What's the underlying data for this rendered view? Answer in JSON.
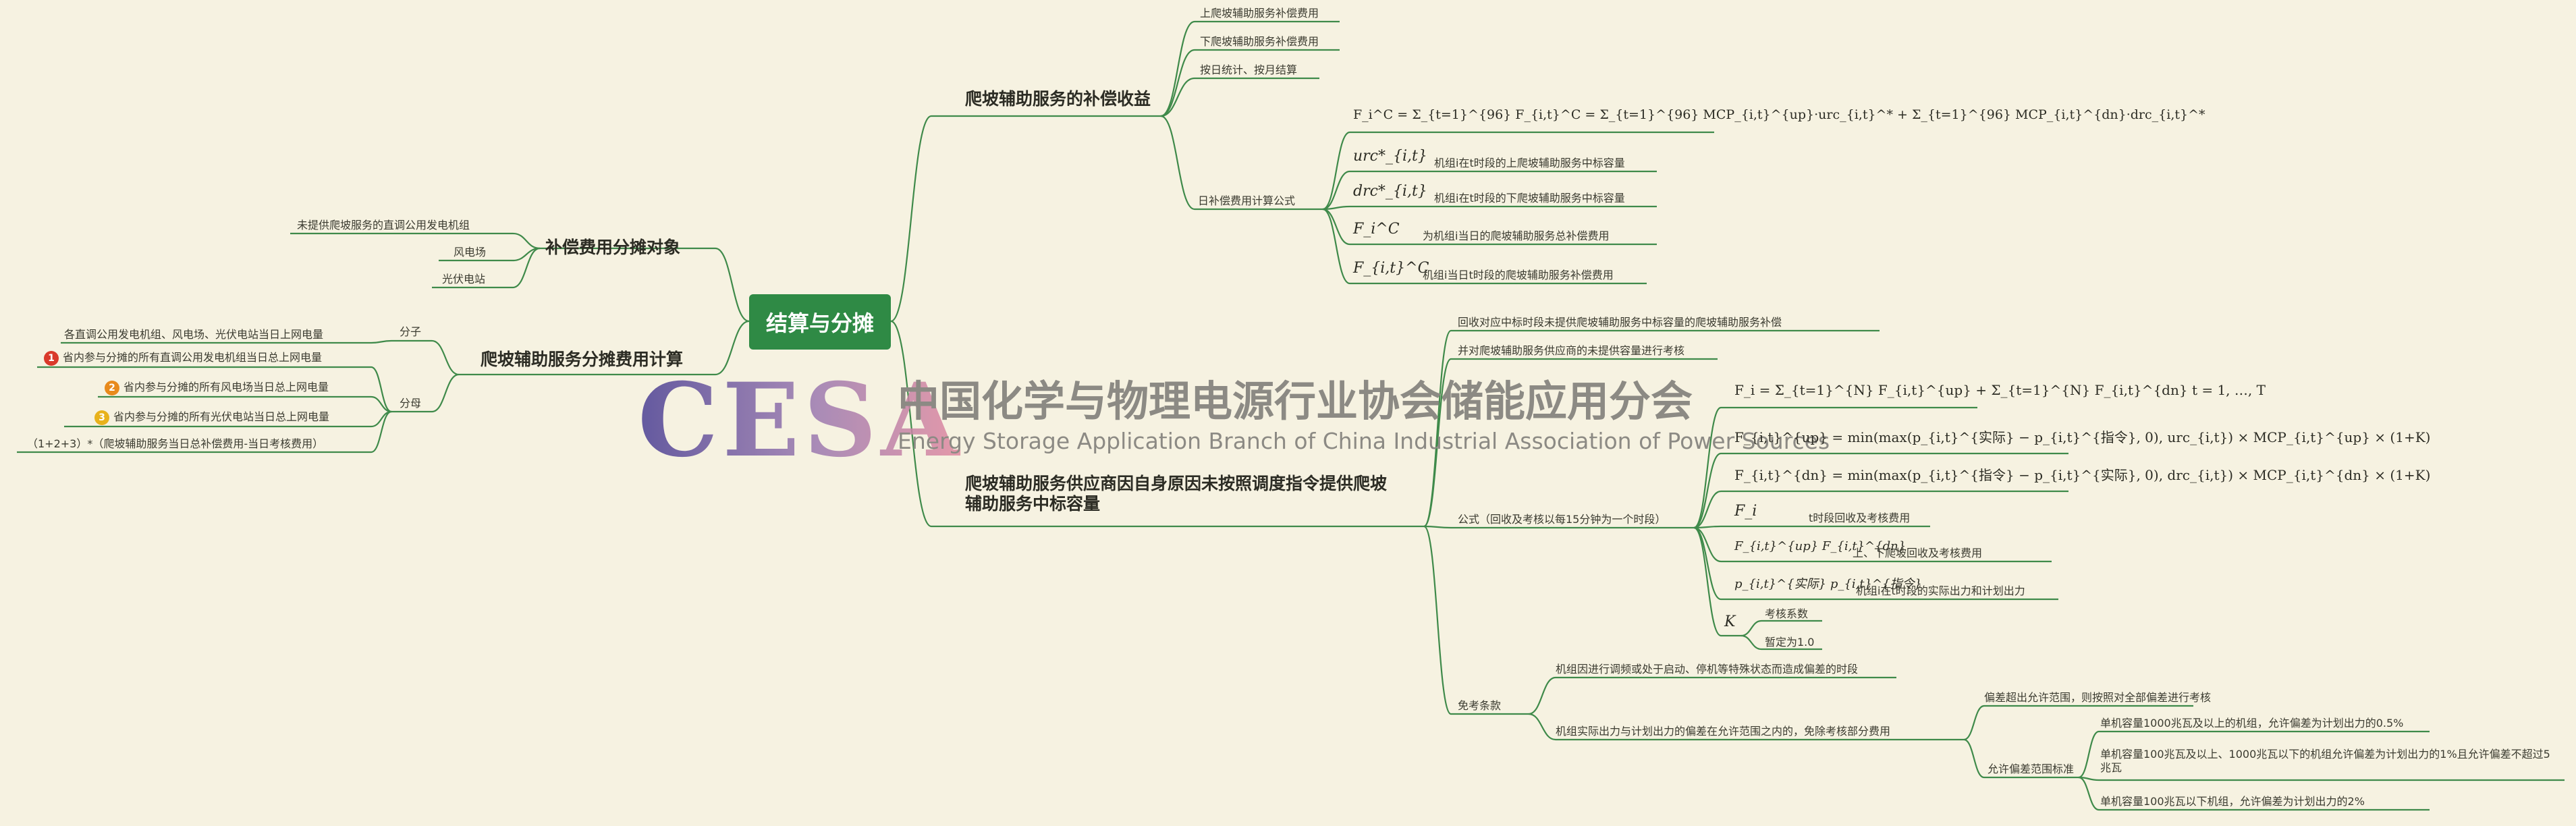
{
  "root": {
    "label": "结算与分摊"
  },
  "watermark": {
    "logo": "CESA",
    "cn": "中国化学与物理电源行业协会储能应用分会",
    "en": "Energy Storage Application Branch of China Industrial Association of Power Sources"
  },
  "right": {
    "branch1": {
      "label": "爬坡辅助服务的补偿收益",
      "items": [
        "上爬坡辅助服务补偿费用",
        "下爬坡辅助服务补偿费用",
        "按日统计、按月结算"
      ],
      "daily": {
        "label": "日补偿费用计算公式",
        "formula": "F_i^C = Σ_{t=1}^{96} F_{i,t}^C = Σ_{t=1}^{96} MCP_{i,t}^{up}·urc_{i,t}^* + Σ_{t=1}^{96} MCP_{i,t}^{dn}·drc_{i,t}^*",
        "defs": [
          {
            "sym": "urc*_{i,t}",
            "text": "机组i在t时段的上爬坡辅助服务中标容量"
          },
          {
            "sym": "drc*_{i,t}",
            "text": "机组i在t时段的下爬坡辅助服务中标容量"
          },
          {
            "sym": "F_i^C",
            "text": "为机组i当日的爬坡辅助服务总补偿费用"
          },
          {
            "sym": "F_{i,t}^C",
            "text": "机组i当日t时段的爬坡辅助服务补偿费用"
          }
        ]
      }
    },
    "branch2": {
      "label": "爬坡辅助服务供应商因自身原因未按照调度指令提供爬坡辅助服务中标容量",
      "items": [
        "回收对应中标时段未提供爬坡辅助服务中标容量的爬坡辅助服务补偿",
        "并对爬坡辅助服务供应商的未提供容量进行考核"
      ],
      "formula": {
        "label": "公式（回收及考核以每15分钟为一个时段）",
        "f1": "F_i = Σ_{t=1}^{N} F_{i,t}^{up} + Σ_{t=1}^{N} F_{i,t}^{dn}      t = 1, …, T",
        "f2": "F_{i,t}^{up} = min(max(p_{i,t}^{实际} − p_{i,t}^{指令}, 0), urc_{i,t}) × MCP_{i,t}^{up} × (1+K)",
        "f3": "F_{i,t}^{dn} = min(max(p_{i,t}^{指令} − p_{i,t}^{实际}, 0), drc_{i,t}) × MCP_{i,t}^{dn} × (1+K)",
        "defs": [
          {
            "sym": "F_i",
            "text": "t时段回收及考核费用"
          },
          {
            "sym": "F_{i,t}^{up}  F_{i,t}^{dn}",
            "text": "上、下爬坡回收及考核费用"
          },
          {
            "sym": "p_{i,t}^{实际}  p_{i,t}^{指令}",
            "text": "机组i在t时段的实际出力和计划出力"
          },
          {
            "sym": "K",
            "text": "考核系数",
            "sub": "暂定为1.0"
          }
        ]
      },
      "exempt": {
        "label": "免考条款",
        "c1": "机组因进行调频或处于启动、停机等特殊状态而造成偏差的时段",
        "c2": "机组实际出力与计划出力的偏差在允许范围之内的，免除考核部分费用",
        "dev": "偏差超出允许范围，则按照对全部偏差进行考核",
        "allow": {
          "label": "允许偏差范围标准",
          "items": [
            "单机容量1000兆瓦及以上的机组，允许偏差为计划出力的0.5%",
            "单机容量100兆瓦及以上、1000兆瓦以下的机组允许偏差为计划出力的1%且允许偏差不超过5兆瓦",
            "单机容量100兆瓦以下机组，允许偏差为计划出力的2%"
          ]
        }
      }
    }
  },
  "left": {
    "objects": {
      "label": "补偿费用分摊对象",
      "items": [
        "未提供爬坡服务的直调公用发电机组",
        "风电场",
        "光伏电站"
      ]
    },
    "calc": {
      "label": "爬坡辅助服务分摊费用计算",
      "numerator": {
        "label": "分子",
        "text": "各直调公用发电机组、风电场、光伏电站当日上网电量"
      },
      "denominator": {
        "label": "分母",
        "items": [
          {
            "n": "1",
            "color": "#d93a2b",
            "text": "省内参与分摊的所有直调公用发电机组当日总上网电量"
          },
          {
            "n": "2",
            "color": "#e88a1c",
            "text": "省内参与分摊的所有风电场当日总上网电量"
          },
          {
            "n": "3",
            "color": "#e8b21c",
            "text": "省内参与分摊的所有光伏电站当日总上网电量"
          }
        ]
      },
      "result": "（1+2+3）*（爬坡辅助服务当日总补偿费用-当日考核费用）"
    }
  }
}
